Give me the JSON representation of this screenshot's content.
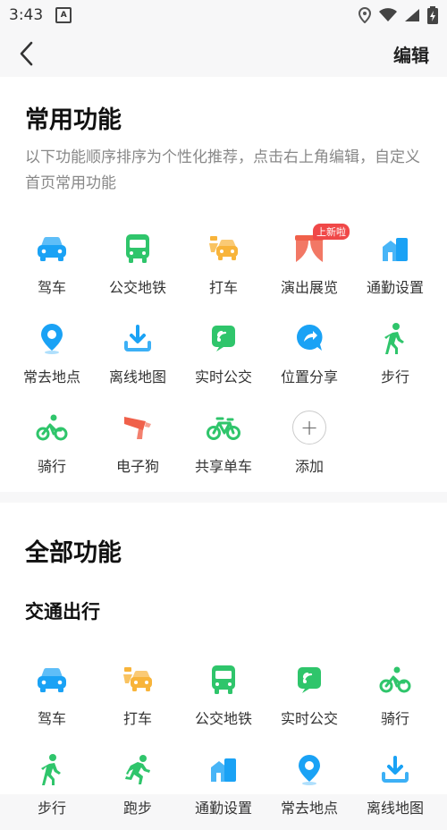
{
  "status": {
    "time": "3:43"
  },
  "header": {
    "edit_label": "编辑"
  },
  "common": {
    "title": "常用功能",
    "description": "以下功能顺序排序为个性化推荐，点击右上角编辑，自定义首页常用功能",
    "items": [
      {
        "label": "驾车",
        "icon": "car-icon",
        "color": "#1aa2f5"
      },
      {
        "label": "公交地铁",
        "icon": "bus-icon",
        "color": "#2fc56b"
      },
      {
        "label": "打车",
        "icon": "taxi-icon",
        "color": "#f8b43a"
      },
      {
        "label": "演出展览",
        "icon": "curtain-icon",
        "color": "#f0604a",
        "badge": "上新啦"
      },
      {
        "label": "通勤设置",
        "icon": "commute-buildings-icon",
        "color": "#1aa2f5"
      },
      {
        "label": "常去地点",
        "icon": "location-pin-icon",
        "color": "#1aa2f5"
      },
      {
        "label": "离线地图",
        "icon": "download-icon",
        "color": "#1aa2f5"
      },
      {
        "label": "实时公交",
        "icon": "realtime-bus-icon",
        "color": "#2fc56b"
      },
      {
        "label": "位置分享",
        "icon": "share-location-icon",
        "color": "#1aa2f5"
      },
      {
        "label": "步行",
        "icon": "walking-icon",
        "color": "#2fc56b"
      },
      {
        "label": "骑行",
        "icon": "cycling-icon",
        "color": "#2fc56b"
      },
      {
        "label": "电子狗",
        "icon": "speed-camera-icon",
        "color": "#f0604a"
      },
      {
        "label": "共享单车",
        "icon": "bike-icon",
        "color": "#2fc56b"
      },
      {
        "label": "添加",
        "icon": "plus-icon",
        "color": "#888888"
      }
    ]
  },
  "all": {
    "title": "全部功能",
    "section_title": "交通出行",
    "items": [
      {
        "label": "驾车",
        "icon": "car-icon",
        "color": "#1aa2f5"
      },
      {
        "label": "打车",
        "icon": "taxi-icon",
        "color": "#f8b43a"
      },
      {
        "label": "公交地铁",
        "icon": "bus-icon",
        "color": "#2fc56b"
      },
      {
        "label": "实时公交",
        "icon": "realtime-bus-icon",
        "color": "#2fc56b"
      },
      {
        "label": "骑行",
        "icon": "cycling-icon",
        "color": "#2fc56b"
      },
      {
        "label": "步行",
        "icon": "walking-icon",
        "color": "#2fc56b"
      },
      {
        "label": "跑步",
        "icon": "running-icon",
        "color": "#2fc56b"
      },
      {
        "label": "通勤设置",
        "icon": "commute-buildings-icon",
        "color": "#1aa2f5"
      },
      {
        "label": "常去地点",
        "icon": "location-pin-icon",
        "color": "#1aa2f5"
      },
      {
        "label": "离线地图",
        "icon": "download-icon",
        "color": "#1aa2f5"
      }
    ]
  }
}
